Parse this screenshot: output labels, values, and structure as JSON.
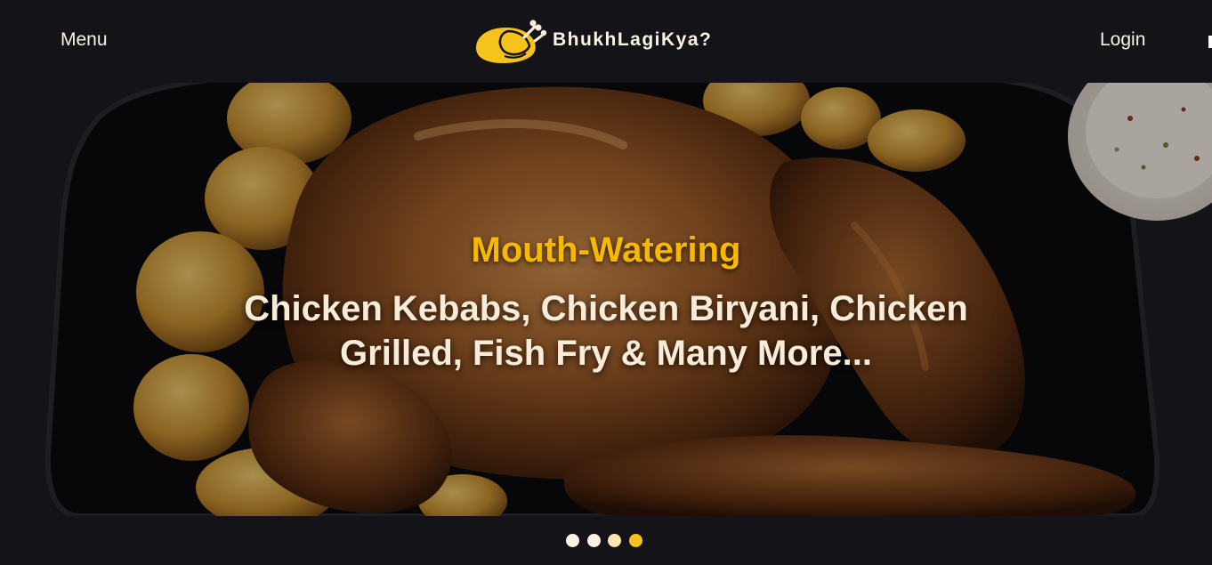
{
  "nav": {
    "menu_label": "Menu",
    "login_label": "Login",
    "brand_name": "BhukhLagiKya?",
    "brand_logo_icon": "roast-chicken-icon"
  },
  "hero": {
    "tagline": "Mouth-Watering",
    "headline": "Chicken Kebabs, Chicken Biryani, Chicken Grilled, Fish Fry & Many More...",
    "image_subject": "roast chicken with potatoes in a dark pan"
  },
  "carousel": {
    "slide_count": 4,
    "active_slide": 4
  },
  "colors": {
    "background": "#141318",
    "accent_yellow": "#f6b800",
    "text_cream": "#fbf3e4",
    "headline_cream": "#f8ecd8",
    "dot_active": "#f6c31c",
    "dot_inactive": "#fbf3e4"
  }
}
